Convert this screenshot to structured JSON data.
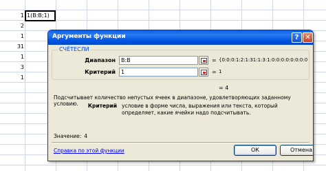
{
  "sheet": {
    "active_cell_text": "1(B:B;1)",
    "first_cell_value": "1",
    "column_values": [
      "2",
      "1",
      "31",
      "1",
      "3",
      "1"
    ]
  },
  "dialog": {
    "title": "Аргументы функции",
    "help_button": "?",
    "close_button": "✕",
    "function_name": "СЧЁТЕСЛИ",
    "args": [
      {
        "label": "Диапазон",
        "value": "B:B",
        "result": "{0:0:0:1:2:1:31:1:3:1:0:0:0:0:0:0:0:0"
      },
      {
        "label": "Критерий",
        "value": "1",
        "result": "1"
      }
    ],
    "equals_sign": "=",
    "result": "= 4",
    "description": "Подсчитывает количество непустых ячеек в диапазоне, удовлетворяющих заданному условию.",
    "param_name": "Критерий",
    "param_description": "условие в форме числа, выражения или текста, который определяет, какие ячейки надо подсчитывать.",
    "value_label": "Значение:",
    "value": "4",
    "help_link": "Справка по этой функции",
    "ok_label": "ОК",
    "cancel_label": "Отмена"
  }
}
